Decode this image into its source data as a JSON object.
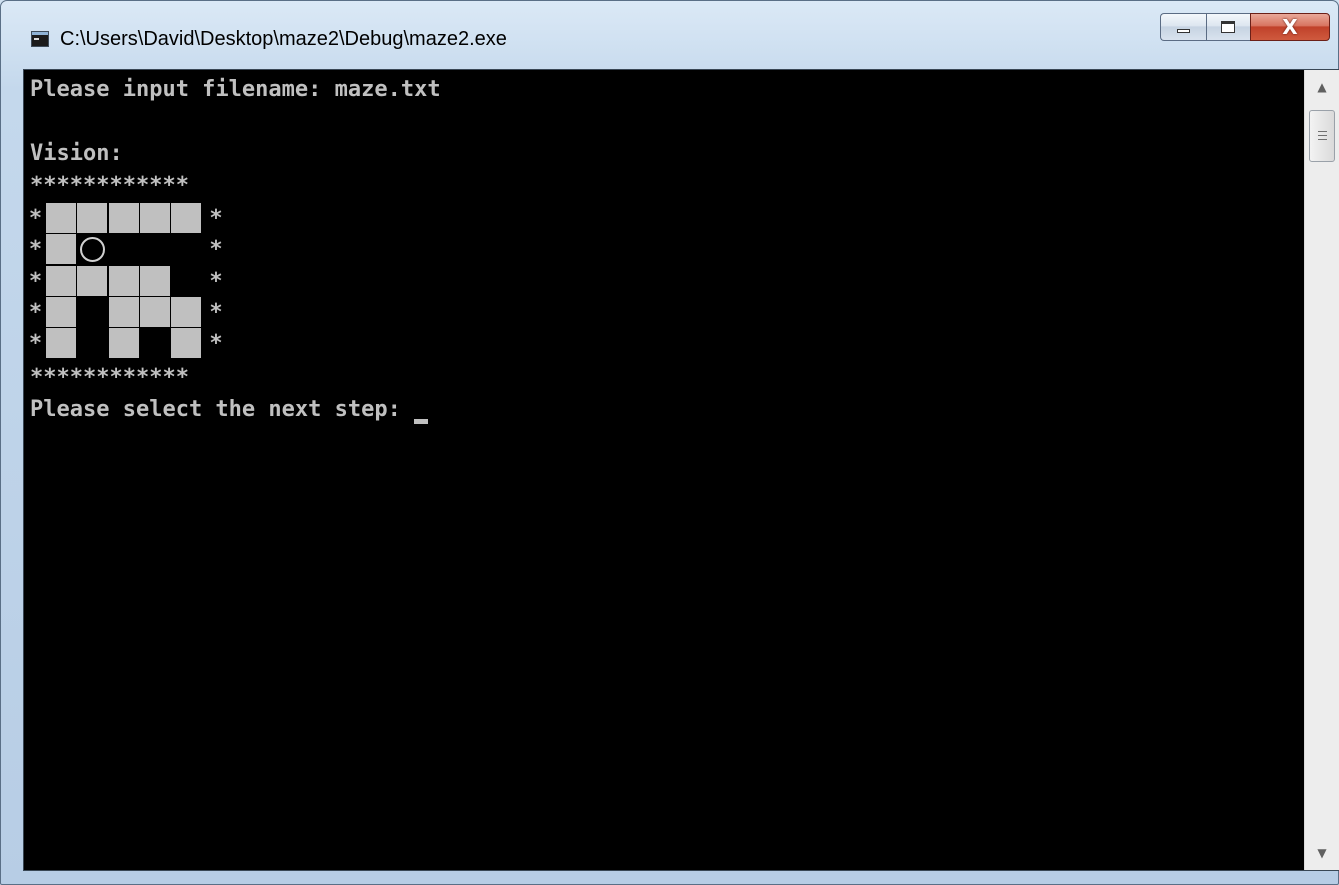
{
  "window": {
    "title": "C:\\Users\\David\\Desktop\\maze2\\Debug\\maze2.exe",
    "controls": {
      "minimize_icon": "minimize-icon",
      "maximize_icon": "maximize-icon",
      "close_icon": "close-icon",
      "close_glyph": "X"
    }
  },
  "console": {
    "line_prompt_file": "Please input filename: maze.txt",
    "line_vision": "Vision:",
    "border_top": "************",
    "border_bottom": "************",
    "star": "*",
    "line_next_step": "Please select the next step: "
  },
  "maze": {
    "rows": [
      [
        "wall",
        "wall",
        "wall",
        "wall",
        "wall"
      ],
      [
        "wall",
        "player",
        "empty",
        "empty",
        "empty"
      ],
      [
        "wall",
        "wall",
        "wall",
        "wall",
        "empty"
      ],
      [
        "wall",
        "empty",
        "wall",
        "wall",
        "wall"
      ],
      [
        "wall",
        "empty",
        "wall",
        "empty",
        "wall"
      ]
    ]
  },
  "scrollbar": {
    "up_icon": "scroll-up-icon",
    "down_icon": "scroll-down-icon",
    "up_glyph": "▲",
    "down_glyph": "▼"
  }
}
